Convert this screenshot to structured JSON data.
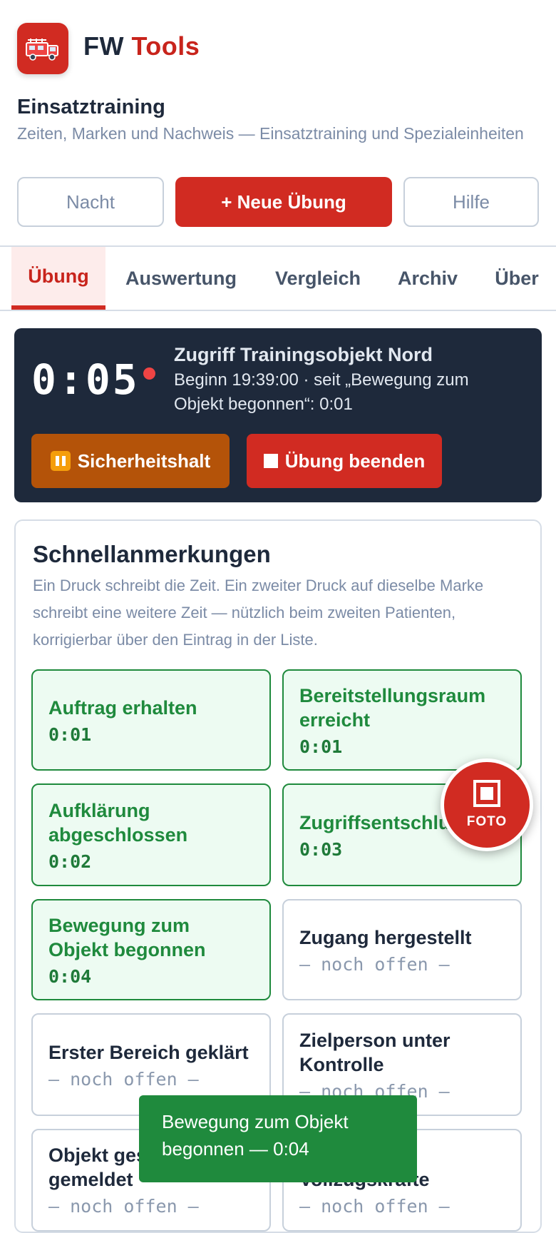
{
  "header": {
    "brand_part1": "FW",
    "brand_part2": "Tools",
    "logo_icon": "fire-truck-icon",
    "title": "Einsatztraining",
    "subtitle": "Zeiten, Marken und Nachweis — Einsatztraining und Spezialeinheiten"
  },
  "actions": {
    "night": "Nacht",
    "new_exercise": "+ Neue Übung",
    "help": "Hilfe"
  },
  "tabs": [
    {
      "label": "Übung",
      "active": true
    },
    {
      "label": "Auswertung"
    },
    {
      "label": "Vergleich"
    },
    {
      "label": "Archiv"
    },
    {
      "label": "Über"
    }
  ],
  "timer": {
    "elapsed": "0:05",
    "operation": "Zugriff Trainingsobjekt Nord",
    "meta": "Beginn 19:39:00 · seit „Bewegung zum Objekt begonnen“: 0:01",
    "pause_label": "Sicherheitshalt",
    "stop_label": "Übung beenden"
  },
  "quick_notes": {
    "title": "Schnellanmerkungen",
    "description": "Ein Druck schreibt die Zeit. Ein zweiter Druck auf dieselbe Marke schreibt eine weitere Zeit — nützlich beim zweiten Patienten, korrigierbar über den Eintrag in der Liste.",
    "marks": [
      {
        "label": "Auftrag erhalten",
        "time": "0:01",
        "done": true
      },
      {
        "label": "Bereitstellungsraum erreicht",
        "time": "0:01",
        "done": true
      },
      {
        "label": "Aufklärung abgeschlossen",
        "time": "0:02",
        "done": true
      },
      {
        "label": "Zugriffsentschluss",
        "time": "0:03",
        "done": true
      },
      {
        "label": "Bewegung zum Objekt begonnen",
        "time": "0:04",
        "done": true
      },
      {
        "label": "Zugang hergestellt",
        "time": "— noch offen —",
        "done": false
      },
      {
        "label": "Erster Bereich geklärt",
        "time": "— noch offen —",
        "done": false
      },
      {
        "label": "Zielperson unter Kontrolle",
        "time": "— noch offen —",
        "done": false
      },
      {
        "label": "Objekt gesichert gemeldet",
        "time": "— noch offen —",
        "done": false
      },
      {
        "label": "Vollzugskräfte",
        "time": "— noch offen —",
        "done": false
      }
    ]
  },
  "fab": {
    "label": "FOTO"
  },
  "toast": {
    "text": "Bewegung zum Objekt begonnen — 0:04"
  },
  "colors": {
    "accent": "#d12b22",
    "done": "#1f8a3d",
    "dark_panel": "#1e293b",
    "pause": "#b45309"
  }
}
